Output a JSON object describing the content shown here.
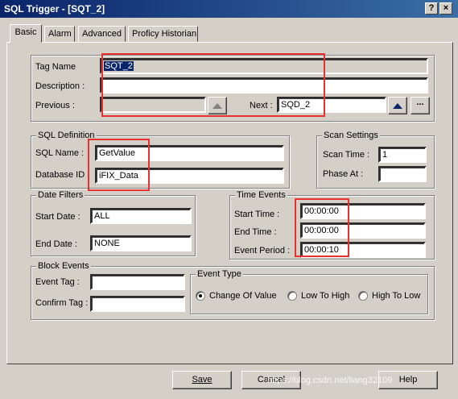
{
  "window": {
    "title": "SQL Trigger - [SQT_2]",
    "help_glyph": "?",
    "close_glyph": "×"
  },
  "tabs": [
    {
      "label": "Basic",
      "active": true
    },
    {
      "label": "Alarm"
    },
    {
      "label": "Advanced"
    },
    {
      "label": "Proficy Historian"
    }
  ],
  "tag": {
    "name_label": "Tag Name",
    "name_value": "SQT_2",
    "description_label": "Description :",
    "description_value": "",
    "previous_label": "Previous :",
    "previous_value": "",
    "next_label": "Next :",
    "next_value": "SQD_2",
    "browse_label": "..."
  },
  "sql_definition": {
    "legend": "SQL Definition",
    "sql_name_label": "SQL Name :",
    "sql_name_value": "GetValue",
    "database_id_label": "Database ID",
    "database_id_value": "iFIX_Data"
  },
  "scan_settings": {
    "legend": "Scan Settings",
    "scan_time_label": "Scan Time :",
    "scan_time_value": "1",
    "phase_at_label": "Phase At :",
    "phase_at_value": ""
  },
  "date_filters": {
    "legend": "Date Filters",
    "start_label": "Start Date :",
    "start_value": "ALL",
    "end_label": "End Date :",
    "end_value": "NONE"
  },
  "time_events": {
    "legend": "Time Events",
    "start_label": "Start Time :",
    "start_value": "00:00:00",
    "end_label": "End Time :",
    "end_value": "00:00:00",
    "period_label": "Event Period :",
    "period_value": "00:00:10"
  },
  "block_events": {
    "legend": "Block Events",
    "event_tag_label": "Event Tag :",
    "event_tag_value": "",
    "confirm_tag_label": "Confirm Tag :",
    "confirm_tag_value": ""
  },
  "event_type": {
    "legend": "Event Type",
    "options": [
      "Change Of Value",
      "Low To High",
      "High To Low"
    ],
    "selected": "Change Of Value"
  },
  "buttons": {
    "save": "Save",
    "cancel": "Cancel",
    "help": "Help"
  },
  "watermark": "https://blog.csdn.net/liang32109",
  "colors": {
    "titlebar": "#0a246a",
    "highlight": "#e8302f",
    "dialog": "#d4d0c8"
  }
}
